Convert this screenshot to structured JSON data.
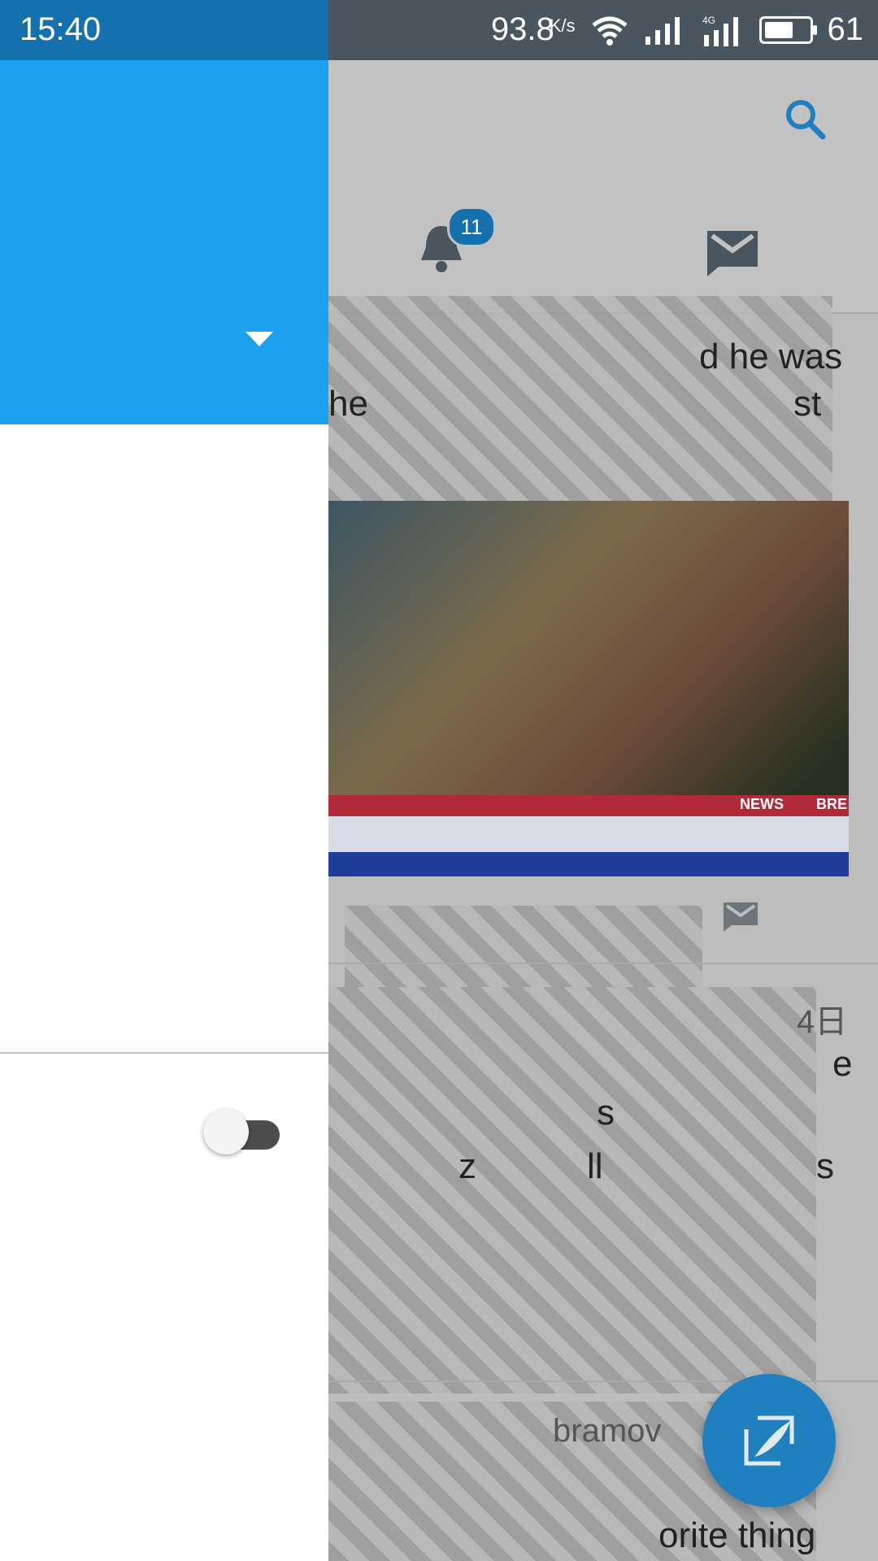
{
  "status_bar": {
    "time": "15:40",
    "network_speed": "93.8",
    "network_speed_unit": "K/s",
    "battery_level": "61"
  },
  "main": {
    "notifications_badge": "11",
    "feed_fragments": {
      "line1": "d he was",
      "line2": "he",
      "line3": "st",
      "date_char": "4日",
      "frag_a": "e",
      "frag_b": "s",
      "frag_c": "z",
      "frag_d": "ll",
      "frag_e": "s",
      "username_fragment": "bramov",
      "last_line": "orite thing"
    },
    "image_labels": {
      "news": "NEWS",
      "bre": "BRE"
    }
  },
  "drawer": {
    "toggle_on": false
  }
}
